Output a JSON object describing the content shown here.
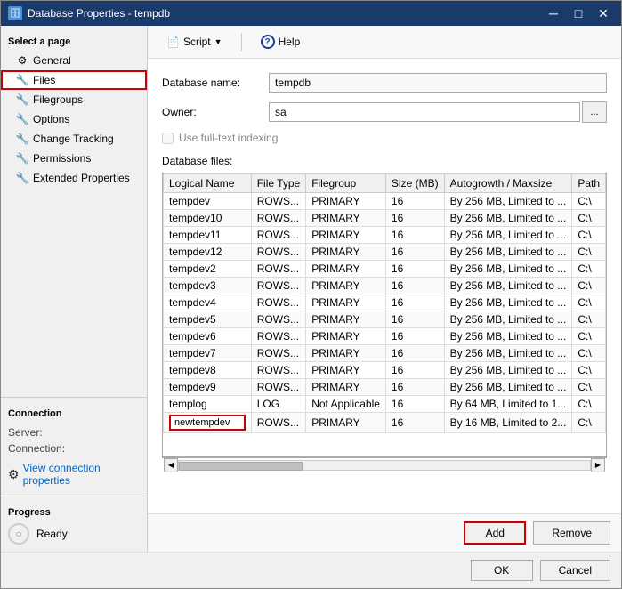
{
  "window": {
    "title": "Database Properties - tempdb",
    "icon": "🗄"
  },
  "titlebar_buttons": {
    "minimize": "─",
    "maximize": "□",
    "close": "✕"
  },
  "sidebar": {
    "select_page_label": "Select a page",
    "items": [
      {
        "id": "general",
        "label": "General",
        "icon": "⚙"
      },
      {
        "id": "files",
        "label": "Files",
        "icon": "🔧",
        "selected": true
      },
      {
        "id": "filegroups",
        "label": "Filegroups",
        "icon": "🔧"
      },
      {
        "id": "options",
        "label": "Options",
        "icon": "🔧"
      },
      {
        "id": "change-tracking",
        "label": "Change Tracking",
        "icon": "🔧"
      },
      {
        "id": "permissions",
        "label": "Permissions",
        "icon": "🔧"
      },
      {
        "id": "extended-properties",
        "label": "Extended Properties",
        "icon": "🔧"
      }
    ]
  },
  "connection": {
    "title": "Connection",
    "server_label": "Server:",
    "server_value": "",
    "connection_label": "Connection:",
    "connection_value": "",
    "view_link": "View connection properties"
  },
  "progress": {
    "title": "Progress",
    "status": "Ready"
  },
  "toolbar": {
    "script_label": "Script",
    "help_label": "Help"
  },
  "form": {
    "database_name_label": "Database name:",
    "database_name_value": "tempdb",
    "owner_label": "Owner:",
    "owner_value": "sa",
    "full_text_label": "Use full-text indexing",
    "db_files_label": "Database files:"
  },
  "table": {
    "columns": [
      "Logical Name",
      "File Type",
      "Filegroup",
      "Size (MB)",
      "Autogrowth / Maxsize",
      "Path"
    ],
    "rows": [
      {
        "logical_name": "tempdev",
        "file_type": "ROWS...",
        "filegroup": "PRIMARY",
        "size": "16",
        "autogrowth": "By 256 MB, Limited to ...",
        "path": "C:\\"
      },
      {
        "logical_name": "tempdev10",
        "file_type": "ROWS...",
        "filegroup": "PRIMARY",
        "size": "16",
        "autogrowth": "By 256 MB, Limited to ...",
        "path": "C:\\"
      },
      {
        "logical_name": "tempdev11",
        "file_type": "ROWS...",
        "filegroup": "PRIMARY",
        "size": "16",
        "autogrowth": "By 256 MB, Limited to ...",
        "path": "C:\\"
      },
      {
        "logical_name": "tempdev12",
        "file_type": "ROWS...",
        "filegroup": "PRIMARY",
        "size": "16",
        "autogrowth": "By 256 MB, Limited to ...",
        "path": "C:\\"
      },
      {
        "logical_name": "tempdev2",
        "file_type": "ROWS...",
        "filegroup": "PRIMARY",
        "size": "16",
        "autogrowth": "By 256 MB, Limited to ...",
        "path": "C:\\"
      },
      {
        "logical_name": "tempdev3",
        "file_type": "ROWS...",
        "filegroup": "PRIMARY",
        "size": "16",
        "autogrowth": "By 256 MB, Limited to ...",
        "path": "C:\\"
      },
      {
        "logical_name": "tempdev4",
        "file_type": "ROWS...",
        "filegroup": "PRIMARY",
        "size": "16",
        "autogrowth": "By 256 MB, Limited to ...",
        "path": "C:\\"
      },
      {
        "logical_name": "tempdev5",
        "file_type": "ROWS...",
        "filegroup": "PRIMARY",
        "size": "16",
        "autogrowth": "By 256 MB, Limited to ...",
        "path": "C:\\"
      },
      {
        "logical_name": "tempdev6",
        "file_type": "ROWS...",
        "filegroup": "PRIMARY",
        "size": "16",
        "autogrowth": "By 256 MB, Limited to ...",
        "path": "C:\\"
      },
      {
        "logical_name": "tempdev7",
        "file_type": "ROWS...",
        "filegroup": "PRIMARY",
        "size": "16",
        "autogrowth": "By 256 MB, Limited to ...",
        "path": "C:\\"
      },
      {
        "logical_name": "tempdev8",
        "file_type": "ROWS...",
        "filegroup": "PRIMARY",
        "size": "16",
        "autogrowth": "By 256 MB, Limited to ...",
        "path": "C:\\"
      },
      {
        "logical_name": "tempdev9",
        "file_type": "ROWS...",
        "filegroup": "PRIMARY",
        "size": "16",
        "autogrowth": "By 256 MB, Limited to ...",
        "path": "C:\\"
      },
      {
        "logical_name": "templog",
        "file_type": "LOG",
        "filegroup": "Not Applicable",
        "size": "16",
        "autogrowth": "By 64 MB, Limited to 1...",
        "path": "C:\\"
      },
      {
        "logical_name": "newtempdev",
        "file_type": "ROWS...",
        "filegroup": "PRIMARY",
        "size": "16",
        "autogrowth": "By 16 MB, Limited to 2...",
        "path": "C:\\",
        "editing": true
      }
    ]
  },
  "action_buttons": {
    "add_label": "Add",
    "remove_label": "Remove"
  },
  "bottom_buttons": {
    "ok_label": "OK",
    "cancel_label": "Cancel"
  }
}
